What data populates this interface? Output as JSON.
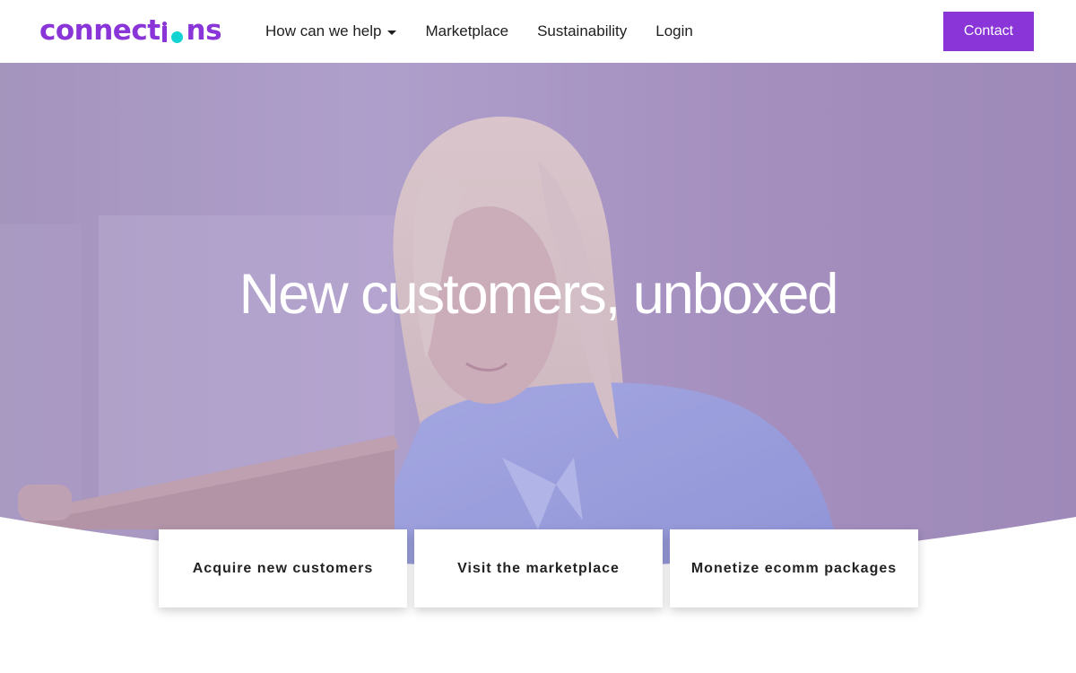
{
  "header": {
    "logo_text": "connections",
    "nav": [
      {
        "label": "How can we help",
        "has_dropdown": true
      },
      {
        "label": "Marketplace"
      },
      {
        "label": "Sustainability"
      },
      {
        "label": "Login"
      }
    ],
    "contact_label": "Contact"
  },
  "hero": {
    "title": "New customers, unboxed"
  },
  "cards": [
    {
      "label": "Acquire new customers"
    },
    {
      "label": "Visit the marketplace"
    },
    {
      "label": "Monetize ecomm packages"
    }
  ],
  "colors": {
    "brand_purple": "#8a35d8",
    "logo_dot": "#14d3d3",
    "hero_tint": "#a897c2"
  },
  "icons": {
    "dropdown": "caret-down-icon"
  }
}
